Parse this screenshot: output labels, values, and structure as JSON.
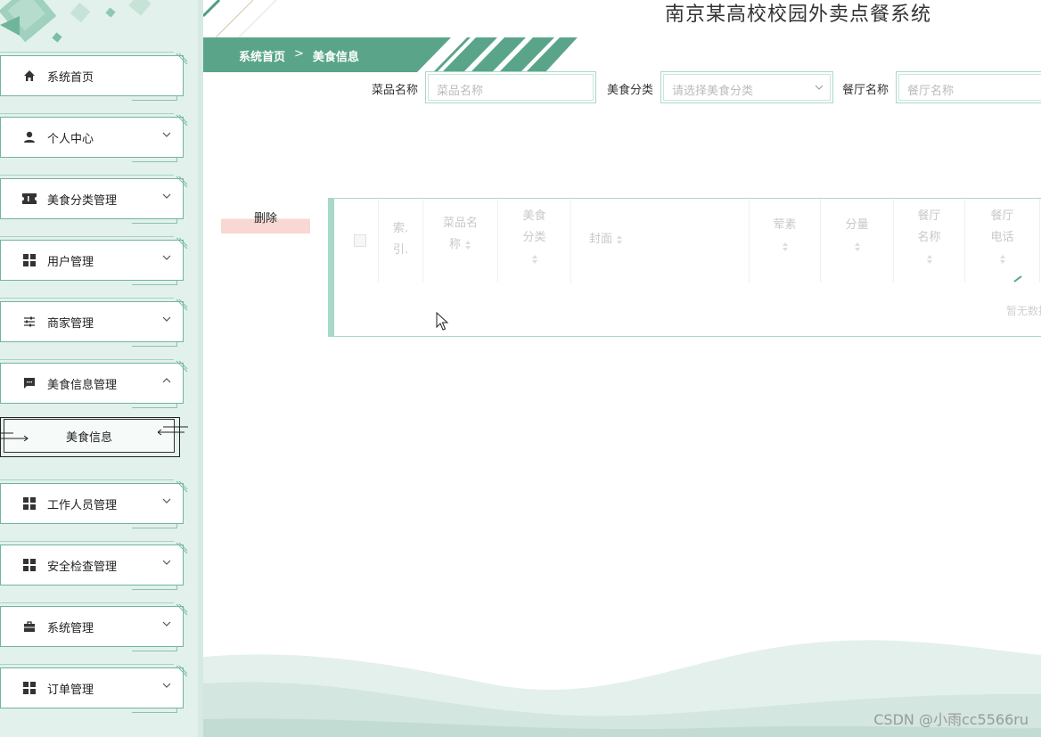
{
  "app": {
    "title": "南京某高校校园外卖点餐系统"
  },
  "breadcrumb": {
    "home": "系统首页",
    "separator": ">",
    "current": "美食信息"
  },
  "sidebar": {
    "items": [
      {
        "label": "系统首页",
        "icon": "home-icon",
        "has_arrow": false
      },
      {
        "label": "个人中心",
        "icon": "user-icon",
        "has_arrow": true
      },
      {
        "label": "美食分类管理",
        "icon": "ticket-icon",
        "has_arrow": true
      },
      {
        "label": "用户管理",
        "icon": "grid-icon",
        "has_arrow": true
      },
      {
        "label": "商家管理",
        "icon": "sliders-icon",
        "has_arrow": true
      },
      {
        "label": "美食信息管理",
        "icon": "chat-icon",
        "has_arrow": true,
        "expanded": true
      },
      {
        "label": "工作人员管理",
        "icon": "grid-icon",
        "has_arrow": true
      },
      {
        "label": "安全检查管理",
        "icon": "grid-icon",
        "has_arrow": true
      },
      {
        "label": "系统管理",
        "icon": "briefcase-icon",
        "has_arrow": true
      },
      {
        "label": "订单管理",
        "icon": "grid-icon",
        "has_arrow": true
      }
    ],
    "submenu": {
      "label": "美食信息"
    }
  },
  "search": {
    "dish_name_label": "菜品名称",
    "dish_name_placeholder": "菜品名称",
    "category_label": "美食分类",
    "category_placeholder": "请选择美食分类",
    "restaurant_label": "餐厅名称",
    "restaurant_placeholder": "餐厅名称"
  },
  "actions": {
    "delete_label": "删除"
  },
  "table": {
    "columns": [
      {
        "line1": "索.",
        "line2": "引."
      },
      {
        "line1": "菜品名",
        "line2": "称"
      },
      {
        "line1": "美食",
        "line2": "分类"
      },
      {
        "line1": "封面",
        "line2": ""
      },
      {
        "line1": "荤素",
        "line2": ""
      },
      {
        "line1": "分量",
        "line2": ""
      },
      {
        "line1": "餐厅",
        "line2": "名称"
      },
      {
        "line1": "餐厅",
        "line2": "电话"
      }
    ],
    "empty_text": "暂无数据"
  },
  "watermark": "CSDN @小雨cc5566ru",
  "colors": {
    "accent": "#5aa58a",
    "accent_light": "#a9d8c7",
    "sidebar_bg": "#e3f1ec",
    "delete_bg": "#f9d7d2"
  }
}
